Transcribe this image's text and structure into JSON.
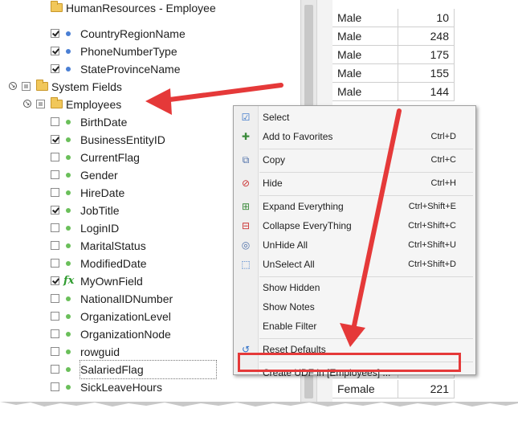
{
  "tree": {
    "rows": [
      {
        "label": "HumanResources - Employee",
        "type": "folder",
        "indent": 1,
        "check": "none"
      },
      {
        "label": "CountryRegionName",
        "type": "field-blue",
        "indent": 2,
        "check": "checked"
      },
      {
        "label": "PhoneNumberType",
        "type": "field-blue",
        "indent": 2,
        "check": "checked"
      },
      {
        "label": "StateProvinceName",
        "type": "field-blue",
        "indent": 2,
        "check": "checked"
      },
      {
        "label": "System Fields",
        "type": "root-folder",
        "indent": 0,
        "check": "partial"
      },
      {
        "label": "Employees",
        "type": "sub-folder",
        "indent": 1,
        "check": "partial"
      },
      {
        "label": "BirthDate",
        "type": "field-green",
        "indent": 2,
        "check": "none"
      },
      {
        "label": "BusinessEntityID",
        "type": "field-green",
        "indent": 2,
        "check": "checked"
      },
      {
        "label": "CurrentFlag",
        "type": "field-green",
        "indent": 2,
        "check": "none"
      },
      {
        "label": "Gender",
        "type": "field-green",
        "indent": 2,
        "check": "none"
      },
      {
        "label": "HireDate",
        "type": "field-green",
        "indent": 2,
        "check": "none"
      },
      {
        "label": "JobTitle",
        "type": "field-green",
        "indent": 2,
        "check": "checked"
      },
      {
        "label": "LoginID",
        "type": "field-green",
        "indent": 2,
        "check": "none"
      },
      {
        "label": "MaritalStatus",
        "type": "field-green",
        "indent": 2,
        "check": "none"
      },
      {
        "label": "ModifiedDate",
        "type": "field-green",
        "indent": 2,
        "check": "none"
      },
      {
        "label": "MyOwnField",
        "type": "field-fx",
        "indent": 2,
        "check": "checked"
      },
      {
        "label": "NationalIDNumber",
        "type": "field-green",
        "indent": 2,
        "check": "none"
      },
      {
        "label": "OrganizationLevel",
        "type": "field-green",
        "indent": 2,
        "check": "none"
      },
      {
        "label": "OrganizationNode",
        "type": "field-green",
        "indent": 2,
        "check": "none"
      },
      {
        "label": "rowguid",
        "type": "field-green",
        "indent": 2,
        "check": "none"
      },
      {
        "label": "SalariedFlag",
        "type": "field-green",
        "indent": 2,
        "check": "none",
        "selected": true
      },
      {
        "label": "SickLeaveHours",
        "type": "field-green",
        "indent": 2,
        "check": "none"
      }
    ]
  },
  "grid": {
    "rows": [
      {
        "gender": "Male",
        "value": "10"
      },
      {
        "gender": "Male",
        "value": "248"
      },
      {
        "gender": "Male",
        "value": "175"
      },
      {
        "gender": "Male",
        "value": "155"
      },
      {
        "gender": "Male",
        "value": "144"
      },
      {
        "gender": "Male",
        "value": ""
      },
      {
        "gender": "Female",
        "value": "221"
      }
    ]
  },
  "context_menu": {
    "items": [
      {
        "label": "Select",
        "shortcut": "",
        "icon": "checkbox-icon"
      },
      {
        "label": "Add to Favorites",
        "shortcut": "Ctrl+D",
        "icon": "favorites-icon"
      },
      {
        "sep": true
      },
      {
        "label": "Copy",
        "shortcut": "Ctrl+C",
        "icon": "copy-icon"
      },
      {
        "sep": true
      },
      {
        "label": "Hide",
        "shortcut": "Ctrl+H",
        "icon": "hide-icon"
      },
      {
        "sep": true
      },
      {
        "label": "Expand Everything",
        "shortcut": "Ctrl+Shift+E",
        "icon": "expand-icon"
      },
      {
        "label": "Collapse EveryThing",
        "shortcut": "Ctrl+Shift+C",
        "icon": "collapse-icon"
      },
      {
        "label": "UnHide All",
        "shortcut": "Ctrl+Shift+U",
        "icon": "unhide-icon"
      },
      {
        "label": "UnSelect All",
        "shortcut": "Ctrl+Shift+D",
        "icon": "unselect-icon"
      },
      {
        "sep": true
      },
      {
        "label": "Show Hidden",
        "shortcut": "",
        "icon": ""
      },
      {
        "label": "Show Notes",
        "shortcut": "",
        "icon": ""
      },
      {
        "label": "Enable Filter",
        "shortcut": "",
        "icon": ""
      },
      {
        "sep": true
      },
      {
        "label": "Reset Defaults",
        "shortcut": "",
        "icon": "reset-icon"
      },
      {
        "sep": true
      },
      {
        "label": "Create UDF in [Employees] ...",
        "shortcut": "",
        "icon": "",
        "highlighted": true
      }
    ]
  },
  "colors": {
    "annotation": "#e53939",
    "field_dot_blue": "#4a7fd4",
    "field_dot_green": "#6abf5a",
    "fx_icon": "#2e9b2e",
    "folder": "#f1c75a"
  }
}
